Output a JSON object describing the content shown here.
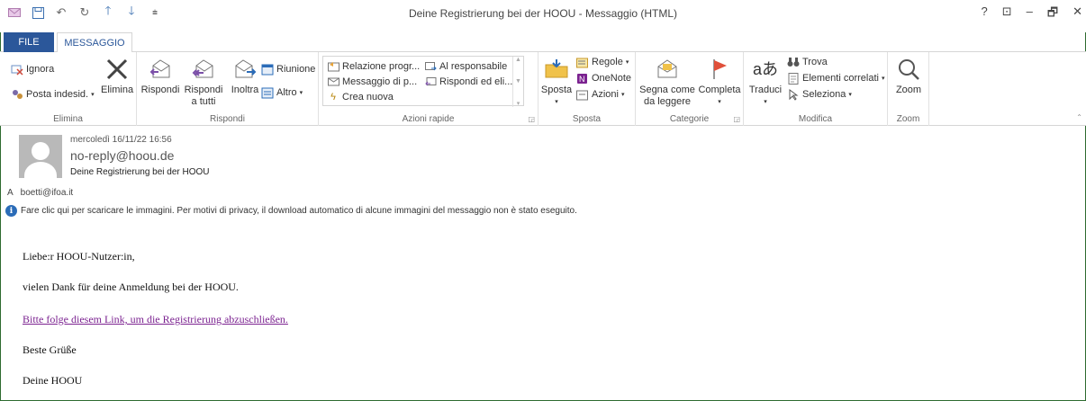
{
  "window": {
    "title": "Deine Registrierung bei der HOOU - Messaggio (HTML)",
    "controls": [
      "?",
      "⊡",
      "–",
      "🗗",
      "✕"
    ]
  },
  "qat": {
    "icons": [
      "mail-icon",
      "save-icon",
      "undo-icon",
      "redo-icon",
      "up-arrow-icon",
      "down-arrow-icon",
      "customize-icon"
    ]
  },
  "tabs": {
    "file": "FILE",
    "message": "MESSAGGIO"
  },
  "ribbon": {
    "elimina": {
      "label": "Elimina",
      "ignore": "Ignora",
      "junk": "Posta indesid.",
      "delete": "Elimina"
    },
    "rispondi": {
      "label": "Rispondi",
      "reply": "Rispondi",
      "reply_all_1": "Rispondi",
      "reply_all_2": "a tutti",
      "forward": "Inoltra",
      "meeting": "Riunione",
      "more": "Altro"
    },
    "quick_steps": {
      "label": "Azioni rapide",
      "items": [
        "Relazione progr...",
        "Al responsabile",
        "Messaggio di p...",
        "Rispondi ed eli...",
        "Crea nuova"
      ]
    },
    "sposta": {
      "label": "Sposta",
      "move": "Sposta",
      "rules": "Regole",
      "onenote": "OneNote",
      "actions": "Azioni"
    },
    "categorie": {
      "label": "Categorie",
      "mark_unread_1": "Segna come",
      "mark_unread_2": "da leggere",
      "complete": "Completa"
    },
    "modifica": {
      "label": "Modifica",
      "translate": "Traduci",
      "find": "Trova",
      "related": "Elementi correlati",
      "select": "Seleziona"
    },
    "zoom": {
      "label": "Zoom",
      "zoom": "Zoom"
    }
  },
  "message": {
    "date": "mercoledì 16/11/22 16:56",
    "sender": "no-reply@hoou.de",
    "subject": "Deine Registrierung bei der HOOU",
    "to_label": "A",
    "to": "boetti@ifoa.it",
    "info": "Fare clic qui per scaricare le immagini. Per motivi di privacy, il download automatico di alcune immagini del messaggio non è stato eseguito.",
    "body": {
      "greeting": "Liebe:r HOOU-Nutzer:in,",
      "line1": "vielen Dank für deine Anmeldung bei der HOOU.",
      "link": "Bitte folge diesem Link, um die Registrierung abzuschließen.",
      "closing": "Beste Grüße",
      "signature": "Deine HOOU"
    }
  },
  "colors": {
    "accent": "#2b579a",
    "link": "#7b2290",
    "flag": "#e0503a",
    "frame": "#2e6b30"
  }
}
